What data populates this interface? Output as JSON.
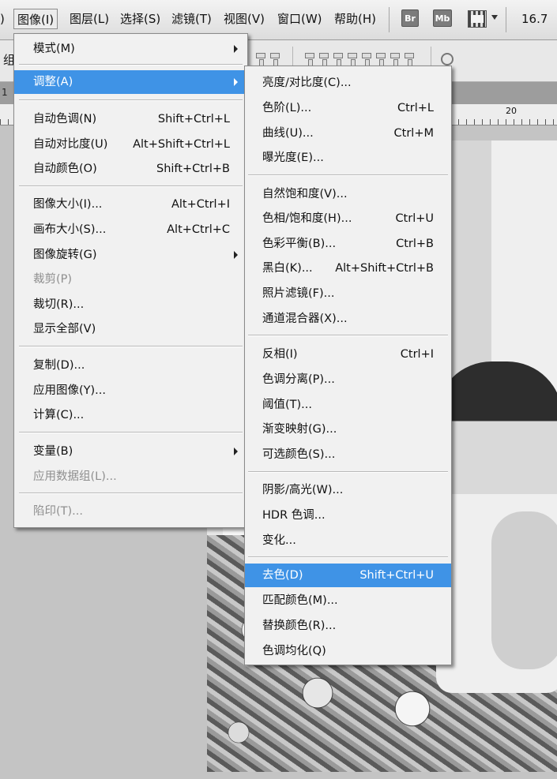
{
  "menubar": {
    "left_fragment": ")",
    "items": [
      {
        "label": "图像(I)"
      },
      {
        "label": "图层(L)"
      },
      {
        "label": "选择(S)"
      },
      {
        "label": "滤镜(T)"
      },
      {
        "label": "视图(V)"
      },
      {
        "label": "窗口(W)"
      },
      {
        "label": "帮助(H)"
      }
    ],
    "br_label": "Br",
    "mb_label": "Mb",
    "zoom": "16.7"
  },
  "options": {
    "left_text": "组"
  },
  "tabstrip": {
    "text": "1"
  },
  "ruler": {
    "label": "20"
  },
  "image_menu": {
    "items": [
      {
        "label": "模式(M)",
        "shortcut": ""
      },
      {
        "label": "调整(A)",
        "shortcut": ""
      },
      {
        "label": "自动色调(N)",
        "shortcut": "Shift+Ctrl+L"
      },
      {
        "label": "自动对比度(U)",
        "shortcut": "Alt+Shift+Ctrl+L"
      },
      {
        "label": "自动颜色(O)",
        "shortcut": "Shift+Ctrl+B"
      },
      {
        "label": "图像大小(I)...",
        "shortcut": "Alt+Ctrl+I"
      },
      {
        "label": "画布大小(S)...",
        "shortcut": "Alt+Ctrl+C"
      },
      {
        "label": "图像旋转(G)",
        "shortcut": ""
      },
      {
        "label": "裁剪(P)",
        "shortcut": ""
      },
      {
        "label": "裁切(R)...",
        "shortcut": ""
      },
      {
        "label": "显示全部(V)",
        "shortcut": ""
      },
      {
        "label": "复制(D)...",
        "shortcut": ""
      },
      {
        "label": "应用图像(Y)...",
        "shortcut": ""
      },
      {
        "label": "计算(C)...",
        "shortcut": ""
      },
      {
        "label": "变量(B)",
        "shortcut": ""
      },
      {
        "label": "应用数据组(L)...",
        "shortcut": ""
      },
      {
        "label": "陷印(T)...",
        "shortcut": ""
      }
    ]
  },
  "adjust_menu": {
    "items": [
      {
        "label": "亮度/对比度(C)...",
        "shortcut": ""
      },
      {
        "label": "色阶(L)...",
        "shortcut": "Ctrl+L"
      },
      {
        "label": "曲线(U)...",
        "shortcut": "Ctrl+M"
      },
      {
        "label": "曝光度(E)...",
        "shortcut": ""
      },
      {
        "label": "自然饱和度(V)...",
        "shortcut": ""
      },
      {
        "label": "色相/饱和度(H)...",
        "shortcut": "Ctrl+U"
      },
      {
        "label": "色彩平衡(B)...",
        "shortcut": "Ctrl+B"
      },
      {
        "label": "黑白(K)...",
        "shortcut": "Alt+Shift+Ctrl+B"
      },
      {
        "label": "照片滤镜(F)...",
        "shortcut": ""
      },
      {
        "label": "通道混合器(X)...",
        "shortcut": ""
      },
      {
        "label": "反相(I)",
        "shortcut": "Ctrl+I"
      },
      {
        "label": "色调分离(P)...",
        "shortcut": ""
      },
      {
        "label": "阈值(T)...",
        "shortcut": ""
      },
      {
        "label": "渐变映射(G)...",
        "shortcut": ""
      },
      {
        "label": "可选颜色(S)...",
        "shortcut": ""
      },
      {
        "label": "阴影/高光(W)...",
        "shortcut": ""
      },
      {
        "label": "HDR 色调...",
        "shortcut": ""
      },
      {
        "label": "变化...",
        "shortcut": ""
      },
      {
        "label": "去色(D)",
        "shortcut": "Shift+Ctrl+U"
      },
      {
        "label": "匹配颜色(M)...",
        "shortcut": ""
      },
      {
        "label": "替换颜色(R)...",
        "shortcut": ""
      },
      {
        "label": "色调均化(Q)",
        "shortcut": ""
      }
    ]
  },
  "colors": {
    "highlight": "#3f93e6",
    "menu_bg": "#f1f1f1",
    "disabled_text": "#8f8f8f"
  }
}
